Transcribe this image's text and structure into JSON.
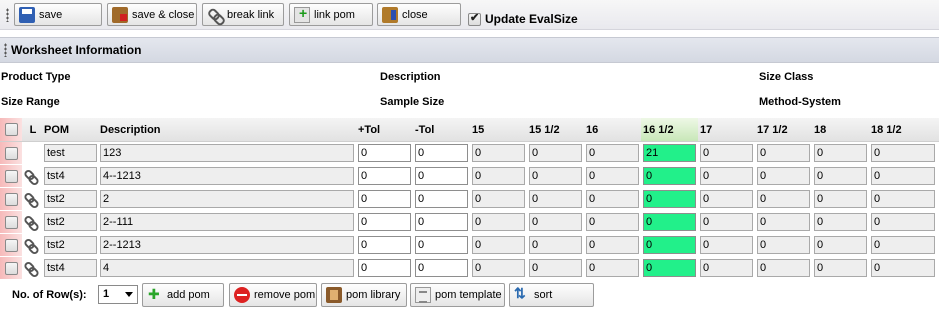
{
  "toolbar": {
    "buttons": [
      {
        "label": "save",
        "icon": "save-icon"
      },
      {
        "label": "save & close",
        "icon": "save-close-icon"
      },
      {
        "label": "break link",
        "icon": "chain-icon"
      },
      {
        "label": "link pom",
        "icon": "link-pom-icon"
      },
      {
        "label": "close",
        "icon": "close-icon"
      }
    ],
    "update_evalsize_label": "Update EvalSize",
    "update_evalsize_checked": true
  },
  "section": {
    "title": "Worksheet Information"
  },
  "info": {
    "product_type": "Product Type",
    "description": "Description",
    "size_class": "Size Class",
    "size_range": "Size Range",
    "sample_size": "Sample Size",
    "method_system": "Method-System"
  },
  "grid": {
    "headers": {
      "l": "L",
      "pom": "POM",
      "description": "Description",
      "plus_tol": "+Tol",
      "minus_tol": "-Tol",
      "s15": "15",
      "s15h": "15 1/2",
      "s16": "16",
      "s16h": "16 1/2",
      "s17": "17",
      "s17h": "17 1/2",
      "s18": "18",
      "s18h": "18 1/2"
    },
    "active_column": "16 1/2",
    "highlight_color": "#22f08a",
    "rows": [
      {
        "linked": false,
        "pom": "test",
        "description": "123",
        "plus_tol": "0",
        "minus_tol": "0",
        "s15": "0",
        "s15h": "0",
        "s16": "0",
        "s16h": "21",
        "s17": "0",
        "s17h": "0",
        "s18": "0",
        "s18h": "0"
      },
      {
        "linked": true,
        "pom": "tst4",
        "description": "4--1213",
        "plus_tol": "0",
        "minus_tol": "0",
        "s15": "0",
        "s15h": "0",
        "s16": "0",
        "s16h": "0",
        "s17": "0",
        "s17h": "0",
        "s18": "0",
        "s18h": "0"
      },
      {
        "linked": true,
        "pom": "tst2",
        "description": "2",
        "plus_tol": "0",
        "minus_tol": "0",
        "s15": "0",
        "s15h": "0",
        "s16": "0",
        "s16h": "0",
        "s17": "0",
        "s17h": "0",
        "s18": "0",
        "s18h": "0"
      },
      {
        "linked": true,
        "pom": "tst2",
        "description": "2--111",
        "plus_tol": "0",
        "minus_tol": "0",
        "s15": "0",
        "s15h": "0",
        "s16": "0",
        "s16h": "0",
        "s17": "0",
        "s17h": "0",
        "s18": "0",
        "s18h": "0"
      },
      {
        "linked": true,
        "pom": "tst2",
        "description": "2--1213",
        "plus_tol": "0",
        "minus_tol": "0",
        "s15": "0",
        "s15h": "0",
        "s16": "0",
        "s16h": "0",
        "s17": "0",
        "s17h": "0",
        "s18": "0",
        "s18h": "0"
      },
      {
        "linked": true,
        "pom": "tst4",
        "description": "4",
        "plus_tol": "0",
        "minus_tol": "0",
        "s15": "0",
        "s15h": "0",
        "s16": "0",
        "s16h": "0",
        "s17": "0",
        "s17h": "0",
        "s18": "0",
        "s18h": "0"
      }
    ]
  },
  "bottom": {
    "rows_label": "No. of Row(s):",
    "rows_value": "1",
    "buttons": [
      {
        "label": "add pom",
        "icon": "add-icon"
      },
      {
        "label": "remove pom",
        "icon": "remove-icon"
      },
      {
        "label": "pom library",
        "icon": "library-icon"
      },
      {
        "label": "pom template",
        "icon": "template-icon"
      },
      {
        "label": "sort",
        "icon": "sort-icon"
      }
    ]
  }
}
